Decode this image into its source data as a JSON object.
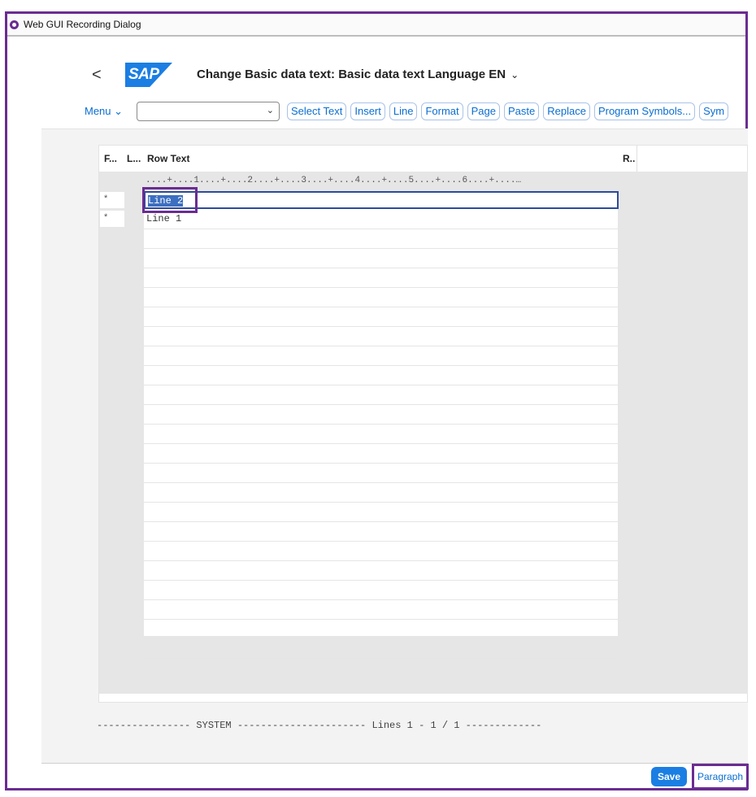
{
  "window": {
    "title": "Web GUI Recording Dialog"
  },
  "header": {
    "back": "<",
    "logo": "SAP",
    "title": "Change Basic data text: Basic data text Language EN"
  },
  "toolbar": {
    "menu_label": "Menu",
    "select_value": "",
    "buttons": [
      "Select Text",
      "Insert",
      "Line",
      "Format",
      "Page",
      "Paste",
      "Replace",
      "Program Symbols...",
      "Sym"
    ]
  },
  "table": {
    "columns": [
      "F...",
      "L...",
      "Row Text",
      "R.."
    ],
    "ruler": "....+....1....+....2....+....3....+....4....+....5....+....6....+....…",
    "rows": [
      {
        "format": "*",
        "text": "Line 2"
      },
      {
        "format": "*",
        "text": "Line 1"
      }
    ]
  },
  "status": {
    "line": "---------------- SYSTEM ---------------------- Lines 1 - 1 / 1 -------------"
  },
  "footer": {
    "save": "Save",
    "paragraph": "Paragraph"
  },
  "colors": {
    "accent": "#6a2c91",
    "brand": "#1b7ee3",
    "link": "#0a6ed1"
  }
}
